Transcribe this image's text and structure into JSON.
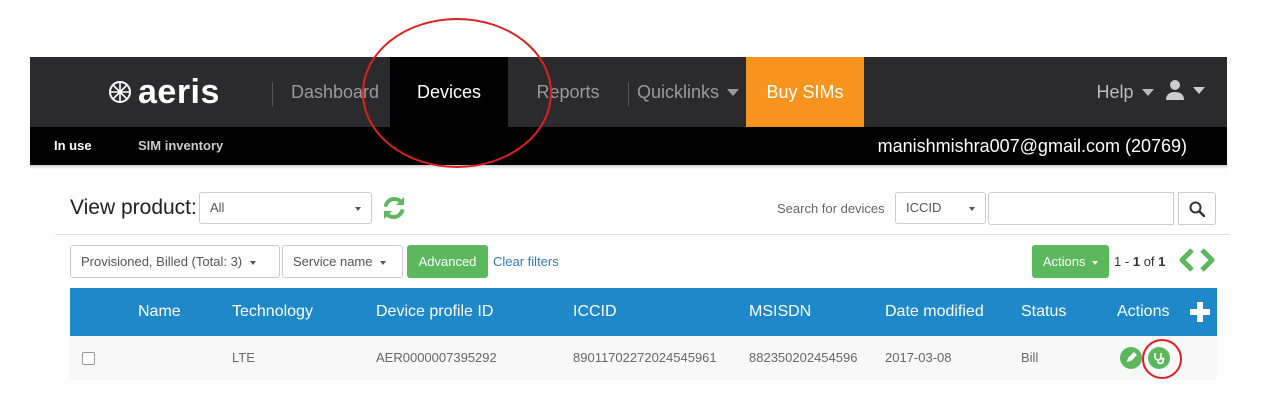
{
  "navbar": {
    "logo": "aeris",
    "items": [
      {
        "label": "Dashboard"
      },
      {
        "label": "Devices"
      },
      {
        "label": "Reports"
      },
      {
        "label": "Quicklinks"
      },
      {
        "label": "Buy SIMs"
      }
    ],
    "help_label": "Help"
  },
  "subnav": {
    "items": [
      {
        "label": "In use"
      },
      {
        "label": "SIM inventory"
      }
    ],
    "account": "manishmishra007@gmail.com (20769)"
  },
  "toolbar": {
    "view_label": "View product:",
    "product_value": "All",
    "search_label": "Search for devices",
    "search_field_value": "ICCID",
    "search_placeholder": ""
  },
  "filters": {
    "status_filter": "Provisioned, Billed (Total: 3)",
    "service_filter": "Service name",
    "advanced_label": "Advanced",
    "clear_label": "Clear filters",
    "actions_label": "Actions",
    "pager": {
      "from": "1",
      "to": "1",
      "of": "1",
      "sep": "-",
      "of_word": "of"
    }
  },
  "table": {
    "columns": [
      "Name",
      "Technology",
      "Device profile ID",
      "ICCID",
      "MSISDN",
      "Date modified",
      "Status",
      "Actions"
    ],
    "rows": [
      {
        "name": "",
        "technology": "LTE",
        "profile_id": "AER0000007395292",
        "iccid": "89011702272024545961",
        "msisdn": "882350202454596",
        "date": "2017-03-08",
        "status": "Bill"
      }
    ]
  },
  "colors": {
    "accent_orange": "#f7941d",
    "green": "#5cb85c",
    "table_header": "#1e88c9"
  },
  "icons": [
    "globe-logo-icon",
    "refresh-icon",
    "search-icon",
    "plus-icon",
    "edit-icon",
    "diagnostics-icon",
    "user-icon",
    "chevron-left-icon",
    "chevron-right-icon"
  ]
}
